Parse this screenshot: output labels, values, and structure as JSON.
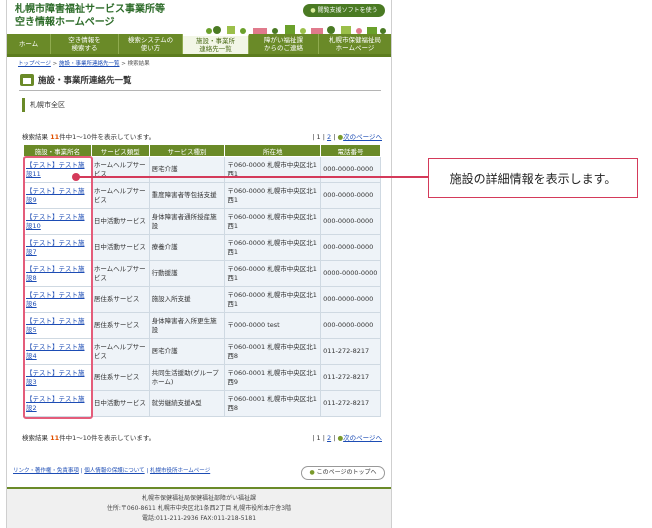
{
  "header": {
    "title_line1": "札幌市障害福祉サービス事業所等",
    "title_line2": "空き情報ホームページ",
    "assist_button": "閲覧支援ソフトを使う"
  },
  "nav": [
    {
      "label": "ホーム"
    },
    {
      "label": "空き情報を\n検索する"
    },
    {
      "label": "検索システムの\n使い方"
    },
    {
      "label": "施設・事業所\n連絡先一覧",
      "active": true
    },
    {
      "label": "障がい福祉課\nからのご連絡"
    },
    {
      "label": "札幌市保健福祉局\nホームページ"
    }
  ],
  "breadcrumb": {
    "home": "トップページ",
    "list": "施設・事業所連絡先一覧",
    "current": "検索結果"
  },
  "page_title": "施設・事業所連絡先一覧",
  "area": "札幌市全区",
  "results": {
    "label": "検索結果",
    "count": "11",
    "suffix": "件中1〜10件を表示しています。",
    "page1": "1",
    "page2": "2",
    "next": "次のページへ"
  },
  "table": {
    "headers": [
      "施設・事業所名",
      "サービス類型",
      "サービス種別",
      "所在地",
      "電話番号"
    ],
    "rows": [
      [
        "【テスト】テスト施設11",
        "ホームヘルプサービス",
        "居宅介護",
        "〒060-0000 札幌市中央区北1西1",
        "000-0000-0000"
      ],
      [
        "【テスト】テスト施設9",
        "ホームヘルプサービス",
        "重度障害者等包括支援",
        "〒060-0000 札幌市中央区北1西1",
        "000-0000-0000"
      ],
      [
        "【テスト】テスト施設10",
        "日中活動サービス",
        "身体障害者通所授産施設",
        "〒060-0000 札幌市中央区北1西1",
        "000-0000-0000"
      ],
      [
        "【テスト】テスト施設7",
        "日中活動サービス",
        "療養介護",
        "〒060-0000 札幌市中央区北1西1",
        "000-0000-0000"
      ],
      [
        "【テスト】テスト施設8",
        "ホームヘルプサービス",
        "行動援護",
        "〒060-0000 札幌市中央区北1西1",
        "0000-0000-0000"
      ],
      [
        "【テスト】テスト施設6",
        "居住系サービス",
        "施設入所支援",
        "〒060-0000 札幌市中央区北1西1",
        "000-0000-0000"
      ],
      [
        "【テスト】テスト施設5",
        "居住系サービス",
        "身体障害者入所更生施設",
        "〒000-0000 test",
        "000-0000-0000"
      ],
      [
        "【テスト】テスト施設4",
        "ホームヘルプサービス",
        "居宅介護",
        "〒060-0001 札幌市中央区北1西8",
        "011-272-8217"
      ],
      [
        "【テスト】テスト施設3",
        "居住系サービス",
        "共同生活援助(グループホーム)",
        "〒060-0001 札幌市中央区北1西9",
        "011-272-8217"
      ],
      [
        "【テスト】テスト施設2",
        "日中活動サービス",
        "就労継続支援A型",
        "〒060-0001 札幌市中央区北1西8",
        "011-272-8217"
      ]
    ]
  },
  "footer_links": [
    "リンク・著作権・免責事項",
    "個人情報の保護について",
    "札幌市役所ホームページ"
  ],
  "to_top": "このページのトップへ",
  "footer": {
    "line1": "札幌市保健福祉局保健福祉部障がい福祉課",
    "line2": "住所:〒060-8611 札幌市中央区北1条西2丁目 札幌市役所本庁舎3階",
    "line3": "電話:011-211-2936 FAX:011-218-5181"
  },
  "callout": "施設の詳細情報を表示します。"
}
